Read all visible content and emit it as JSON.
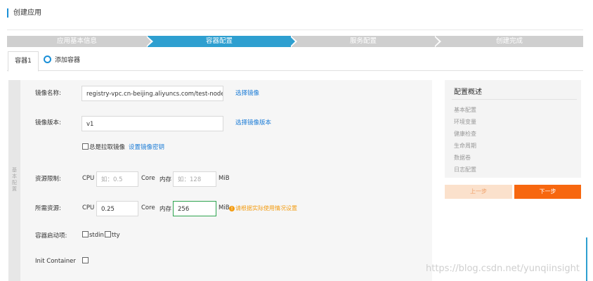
{
  "page": {
    "title": "创建应用"
  },
  "steps": [
    "应用基本信息",
    "容器配置",
    "服务配置",
    "创建完成"
  ],
  "tabs": {
    "active": "容器1",
    "add_label": "添加容器"
  },
  "side_label": "基本配置",
  "form": {
    "image_name": {
      "label": "镜像名称:",
      "value": "registry-vpc.cn-beijing.aliyuncs.com/test-node/noc",
      "link": "选择镜像"
    },
    "image_version": {
      "label": "镜像版本:",
      "value": "v1",
      "link": "选择镜像版本"
    },
    "pull": {
      "label": "总是拉取镜像",
      "link": "设置镜像密钥"
    },
    "limits": {
      "label": "资源限制:",
      "cpu_label": "CPU",
      "cpu_placeholder": "如：0.5",
      "core": "Core",
      "mem_label": "内存",
      "mem_placeholder": "如：128",
      "mib": "MiB"
    },
    "requests": {
      "label": "所需资源:",
      "cpu_label": "CPU",
      "cpu_value": "0.25",
      "core": "Core",
      "mem_label": "内存",
      "mem_value": "256",
      "mib": "MiB",
      "warning": "请根据实际使用情况设置"
    },
    "startup": {
      "label": "容器启动项:",
      "stdin": "stdin",
      "tty": "tty"
    },
    "init": {
      "label": "Init Container"
    }
  },
  "summary": {
    "title": "配置概述",
    "items": [
      "基本配置",
      "环境变量",
      "健康检查",
      "生命周期",
      "数据卷",
      "日志配置"
    ]
  },
  "buttons": {
    "prev": "上一步",
    "next": "下一步"
  },
  "watermark": "https://blog.csdn.net/yunqiinsight",
  "colors": {
    "accent": "#2e9fd0",
    "primary_button": "#f7670f",
    "link": "#1a7bd6",
    "warning": "#f39c12"
  }
}
